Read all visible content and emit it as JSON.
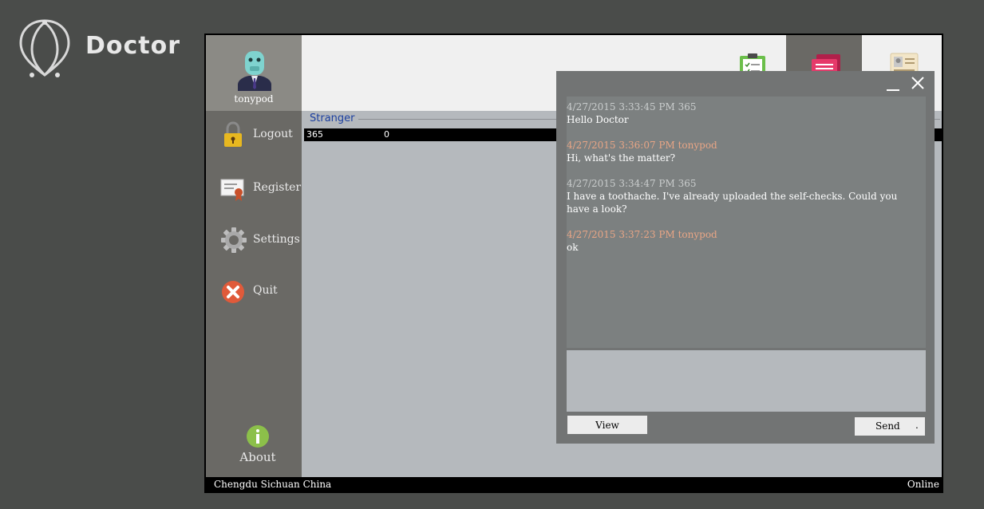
{
  "brand": {
    "name": "Doctor",
    "logo_icon": "pin-logo-icon"
  },
  "user": {
    "name": "tonypod",
    "avatar_icon": "robot-avatar-icon"
  },
  "sidebar": {
    "items": [
      {
        "label": "Logout",
        "icon": "padlock-icon"
      },
      {
        "label": "Register",
        "icon": "certificate-icon"
      },
      {
        "label": "Settings",
        "icon": "gear-icon"
      },
      {
        "label": "Quit",
        "icon": "close-circle-icon"
      }
    ],
    "about": {
      "label": "About",
      "icon": "info-icon"
    }
  },
  "toolbar": {
    "buttons": [
      {
        "icon": "clipboard-checklist-icon"
      },
      {
        "icon": "messages-icon",
        "active": true
      },
      {
        "icon": "id-card-icon"
      }
    ]
  },
  "contacts": {
    "group_title": "Stranger",
    "rows": [
      {
        "id": "365",
        "count": "0"
      }
    ]
  },
  "chat": {
    "messages": [
      {
        "meta": "4/27/2015 3:33:45 PM 365",
        "text": "Hello Doctor",
        "self": false
      },
      {
        "meta": "4/27/2015 3:36:07 PM tonypod",
        "text": "Hi, what's the matter?",
        "self": true
      },
      {
        "meta": "4/27/2015 3:34:47 PM 365",
        "text": "I have a toothache. I've already uploaded the self-checks. Could you have a look?",
        "self": false
      },
      {
        "meta": "4/27/2015 3:37:23 PM tonypod",
        "text": "ok",
        "self": true
      }
    ],
    "input_value": "",
    "view_label": "View",
    "send_label": "Send",
    "send_suffix": "."
  },
  "status": {
    "location": "Chengdu Sichuan China",
    "state": "Online"
  },
  "colors": {
    "background": "#4a4c4a",
    "sidebar": "#6a6965",
    "self_message": "#e8a585",
    "group_title": "#1b3fa0"
  }
}
